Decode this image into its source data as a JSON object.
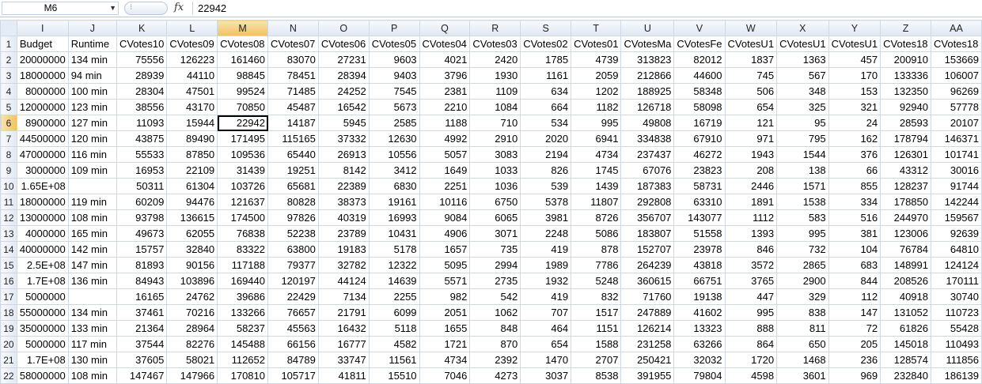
{
  "formula_bar": {
    "name_box": "M6",
    "fx_label": "fx",
    "value": "22942"
  },
  "columns": [
    "I",
    "J",
    "K",
    "L",
    "M",
    "N",
    "O",
    "P",
    "Q",
    "R",
    "S",
    "T",
    "U",
    "V",
    "W",
    "X",
    "Y",
    "Z",
    "AA"
  ],
  "active_column": "M",
  "active_row": "6",
  "rows": [
    {
      "num": "1",
      "cells": [
        "Budget",
        "Runtime",
        "CVotes10",
        "CVotes09",
        "CVotes08",
        "CVotes07",
        "CVotes06",
        "CVotes05",
        "CVotes04",
        "CVotes03",
        "CVotes02",
        "CVotes01",
        "CVotesMa",
        "CVotesFe",
        "CVotesU1",
        "CVotesU1",
        "CVotesU1",
        "CVotes18",
        "CVotes18"
      ]
    },
    {
      "num": "2",
      "cells": [
        "20000000",
        "134 min",
        "75556",
        "126223",
        "161460",
        "83070",
        "27231",
        "9603",
        "4021",
        "2420",
        "1785",
        "4739",
        "313823",
        "82012",
        "1837",
        "1363",
        "457",
        "200910",
        "153669"
      ]
    },
    {
      "num": "3",
      "cells": [
        "18000000",
        "94 min",
        "28939",
        "44110",
        "98845",
        "78451",
        "28394",
        "9403",
        "3796",
        "1930",
        "1161",
        "2059",
        "212866",
        "44600",
        "745",
        "567",
        "170",
        "133336",
        "106007"
      ]
    },
    {
      "num": "4",
      "cells": [
        "8000000",
        "100 min",
        "28304",
        "47501",
        "99524",
        "71485",
        "24252",
        "7545",
        "2381",
        "1109",
        "634",
        "1202",
        "188925",
        "58348",
        "506",
        "348",
        "153",
        "132350",
        "96269"
      ]
    },
    {
      "num": "5",
      "cells": [
        "12000000",
        "123 min",
        "38556",
        "43170",
        "70850",
        "45487",
        "16542",
        "5673",
        "2210",
        "1084",
        "664",
        "1182",
        "126718",
        "58098",
        "654",
        "325",
        "321",
        "92940",
        "57778"
      ]
    },
    {
      "num": "6",
      "cells": [
        "8900000",
        "127 min",
        "11093",
        "15944",
        "22942",
        "14187",
        "5945",
        "2585",
        "1188",
        "710",
        "534",
        "995",
        "49808",
        "16719",
        "121",
        "95",
        "24",
        "28593",
        "20107"
      ]
    },
    {
      "num": "7",
      "cells": [
        "44500000",
        "120 min",
        "43875",
        "89490",
        "171495",
        "115165",
        "37332",
        "12630",
        "4992",
        "2910",
        "2020",
        "6941",
        "334838",
        "67910",
        "971",
        "795",
        "162",
        "178794",
        "146371"
      ]
    },
    {
      "num": "8",
      "cells": [
        "47000000",
        "116 min",
        "55533",
        "87850",
        "109536",
        "65440",
        "26913",
        "10556",
        "5057",
        "3083",
        "2194",
        "4734",
        "237437",
        "46272",
        "1943",
        "1544",
        "376",
        "126301",
        "101741"
      ]
    },
    {
      "num": "9",
      "cells": [
        "3000000",
        "109 min",
        "16953",
        "22109",
        "31439",
        "19251",
        "8142",
        "3412",
        "1649",
        "1033",
        "826",
        "1745",
        "67076",
        "23823",
        "208",
        "138",
        "66",
        "43312",
        "30016"
      ]
    },
    {
      "num": "10",
      "cells": [
        "1.65E+08",
        "",
        "50311",
        "61304",
        "103726",
        "65681",
        "22389",
        "6830",
        "2251",
        "1036",
        "539",
        "1439",
        "187383",
        "58731",
        "2446",
        "1571",
        "855",
        "128237",
        "91744"
      ]
    },
    {
      "num": "11",
      "cells": [
        "18000000",
        "119 min",
        "60209",
        "94476",
        "121637",
        "80828",
        "38373",
        "19161",
        "10116",
        "6750",
        "5378",
        "11807",
        "292808",
        "63310",
        "1891",
        "1538",
        "334",
        "178850",
        "142244"
      ]
    },
    {
      "num": "12",
      "cells": [
        "13000000",
        "108 min",
        "93798",
        "136615",
        "174500",
        "97826",
        "40319",
        "16993",
        "9084",
        "6065",
        "3981",
        "8726",
        "356707",
        "143077",
        "1112",
        "583",
        "516",
        "244970",
        "159567"
      ]
    },
    {
      "num": "13",
      "cells": [
        "4000000",
        "165 min",
        "49673",
        "62055",
        "76838",
        "52238",
        "23789",
        "10431",
        "4906",
        "3071",
        "2248",
        "5086",
        "183807",
        "51558",
        "1393",
        "995",
        "381",
        "123006",
        "92639"
      ]
    },
    {
      "num": "14",
      "cells": [
        "40000000",
        "142 min",
        "15757",
        "32840",
        "83322",
        "63800",
        "19183",
        "5178",
        "1657",
        "735",
        "419",
        "878",
        "152707",
        "23978",
        "846",
        "732",
        "104",
        "76784",
        "64810"
      ]
    },
    {
      "num": "15",
      "cells": [
        "2.5E+08",
        "147 min",
        "81893",
        "90156",
        "117188",
        "79377",
        "32782",
        "12322",
        "5095",
        "2994",
        "1989",
        "7786",
        "264239",
        "43818",
        "3572",
        "2865",
        "683",
        "148991",
        "124124"
      ]
    },
    {
      "num": "16",
      "cells": [
        "1.7E+08",
        "136 min",
        "84943",
        "103896",
        "169440",
        "120197",
        "44124",
        "14639",
        "5571",
        "2735",
        "1932",
        "5248",
        "360615",
        "66751",
        "3765",
        "2900",
        "844",
        "208526",
        "170111"
      ]
    },
    {
      "num": "17",
      "cells": [
        "5000000",
        "",
        "16165",
        "24762",
        "39686",
        "22429",
        "7134",
        "2255",
        "982",
        "542",
        "419",
        "832",
        "71760",
        "19138",
        "447",
        "329",
        "112",
        "40918",
        "30740"
      ]
    },
    {
      "num": "18",
      "cells": [
        "55000000",
        "134 min",
        "37461",
        "70216",
        "133266",
        "76657",
        "21791",
        "6099",
        "2051",
        "1062",
        "707",
        "1517",
        "247889",
        "41602",
        "995",
        "838",
        "147",
        "131052",
        "110723"
      ]
    },
    {
      "num": "19",
      "cells": [
        "35000000",
        "133 min",
        "21364",
        "28964",
        "58237",
        "45563",
        "16432",
        "5118",
        "1655",
        "848",
        "464",
        "1151",
        "126214",
        "13323",
        "888",
        "811",
        "72",
        "61826",
        "55428"
      ]
    },
    {
      "num": "20",
      "cells": [
        "5000000",
        "117 min",
        "37544",
        "82276",
        "145488",
        "66156",
        "16777",
        "4582",
        "1721",
        "870",
        "654",
        "1588",
        "231258",
        "63266",
        "864",
        "650",
        "205",
        "145018",
        "110493"
      ]
    },
    {
      "num": "21",
      "cells": [
        "1.7E+08",
        "130 min",
        "37605",
        "58021",
        "112652",
        "84789",
        "33747",
        "11561",
        "4734",
        "2392",
        "1470",
        "2707",
        "250421",
        "32032",
        "1720",
        "1468",
        "236",
        "128574",
        "111856"
      ]
    },
    {
      "num": "22",
      "cells": [
        "58000000",
        "108 min",
        "147467",
        "147966",
        "170810",
        "105717",
        "41811",
        "15510",
        "7046",
        "4273",
        "3037",
        "8538",
        "391955",
        "79804",
        "4598",
        "3601",
        "969",
        "232840",
        "186139"
      ]
    }
  ]
}
